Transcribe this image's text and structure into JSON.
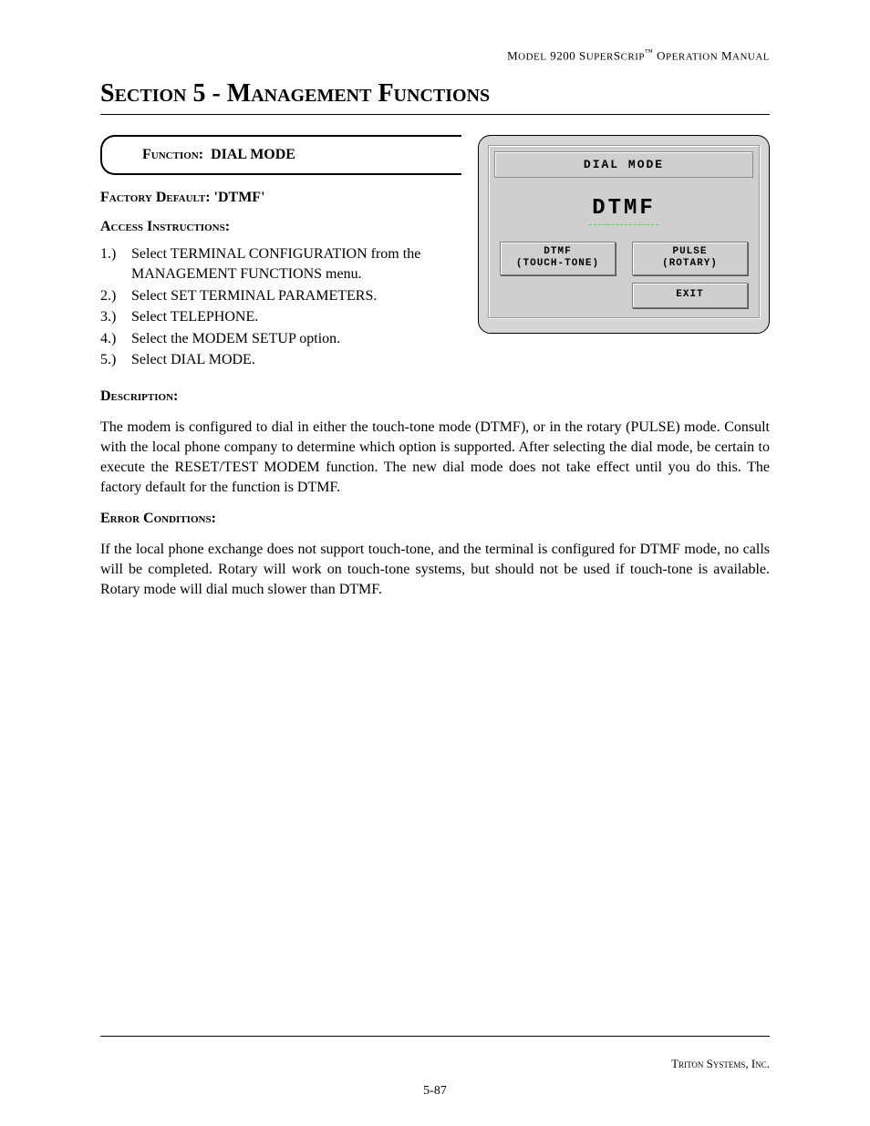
{
  "header": {
    "running": "Model 9200 SuperScrip™ Operation Manual"
  },
  "section_title": "Section 5 - Management Functions",
  "function": {
    "label": "Function:",
    "name": "DIAL MODE"
  },
  "factory_default": {
    "label": "Factory Default:",
    "value": "'DTMF'"
  },
  "access": {
    "label": "Access Instructions:",
    "steps": [
      {
        "num": "1.)",
        "text": "Select TERMINAL CONFIGURATION from the MANAGEMENT FUNCTIONS menu."
      },
      {
        "num": "2.)",
        "text": "Select SET TERMINAL PARAMETERS."
      },
      {
        "num": "3.)",
        "text": "Select TELEPHONE."
      },
      {
        "num": "4.)",
        "text": "Select the MODEM SETUP option."
      },
      {
        "num": "5.)",
        "text": "Select DIAL MODE."
      }
    ]
  },
  "description": {
    "label": "Description:",
    "text": "The modem is configured to dial in either the touch-tone mode (DTMF), or in the rotary (PULSE) mode.  Consult with the local phone company to determine which option is supported.  After selecting the dial mode, be certain to execute the RESET/TEST MODEM function.  The new dial mode does not take effect until you do this.  The factory default for the function is DTMF."
  },
  "error": {
    "label": "Error Conditions:",
    "text": "If the local phone exchange does not support touch-tone, and the terminal is configured for DTMF mode, no calls will be completed.  Rotary will work on touch-tone systems, but should not be used if touch-tone is available.  Rotary mode will dial much slower than DTMF."
  },
  "screen": {
    "title": "DIAL MODE",
    "current": "DTMF",
    "buttons": {
      "left": {
        "line1": "DTMF",
        "line2": "(TOUCH-TONE)"
      },
      "right": {
        "line1": "PULSE",
        "line2": "(ROTARY)"
      },
      "exit": "EXIT"
    }
  },
  "footer": {
    "company": "Triton Systems, Inc.",
    "page": "5-87"
  }
}
